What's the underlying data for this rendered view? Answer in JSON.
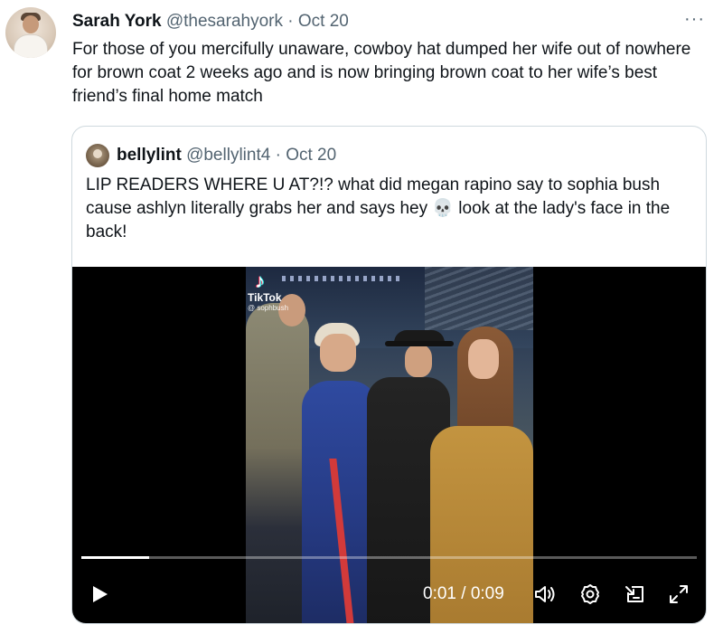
{
  "tweet": {
    "author_name": "Sarah York",
    "author_handle": "@thesarahyork",
    "separator": "·",
    "date": "Oct 20",
    "more_label": "···",
    "text": "For those of you mercifully unaware, cowboy hat dumped her wife out of nowhere for brown coat 2 weeks ago and is now bringing brown coat to her wife’s best friend’s final home match"
  },
  "quoted_tweet": {
    "author_name": "bellylint",
    "author_handle": "@bellylint4",
    "separator": "·",
    "date": "Oct 20",
    "text": "LIP READERS WHERE U AT?!? what did megan rapino say to sophia bush cause ashlyn literally grabs her and says hey 💀 look at the lady's face in the back!"
  },
  "video": {
    "watermark_brand": "TikTok",
    "watermark_user": "@ sophbush",
    "time_display": "0:01 / 0:09",
    "progress": 0.11
  },
  "icons": {
    "more": "more-icon",
    "play": "play-icon",
    "volume": "volume-icon",
    "settings": "gear-icon",
    "pip": "picture-in-picture-icon",
    "fullscreen": "expand-icon"
  },
  "colors": {
    "text_primary": "#0f1419",
    "text_secondary": "#536471",
    "border": "#cfd9de",
    "video_bg": "#000000"
  }
}
